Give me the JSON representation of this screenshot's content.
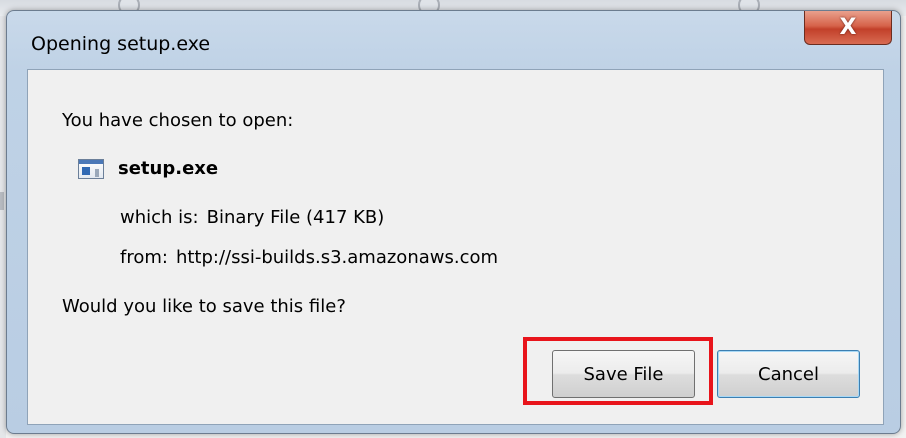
{
  "window": {
    "title": "Opening setup.exe",
    "close_glyph": "X"
  },
  "dialog": {
    "prompt": "You have chosen to open:",
    "file_name": "setup.exe",
    "file_icon": "executable-file-icon",
    "which_label": "which is:",
    "which_value": "Binary File (417 KB)",
    "from_label": "from:",
    "from_value": "http://ssi-builds.s3.amazonaws.com",
    "question": "Would you like to save this file?"
  },
  "buttons": {
    "save_label": "Save File",
    "cancel_label": "Cancel"
  },
  "annotation": {
    "highlight_color": "#e8141b"
  },
  "colors": {
    "title_bar": "#bfd2e6",
    "close_button": "#c2402a",
    "client_bg": "#f0f0f0"
  }
}
